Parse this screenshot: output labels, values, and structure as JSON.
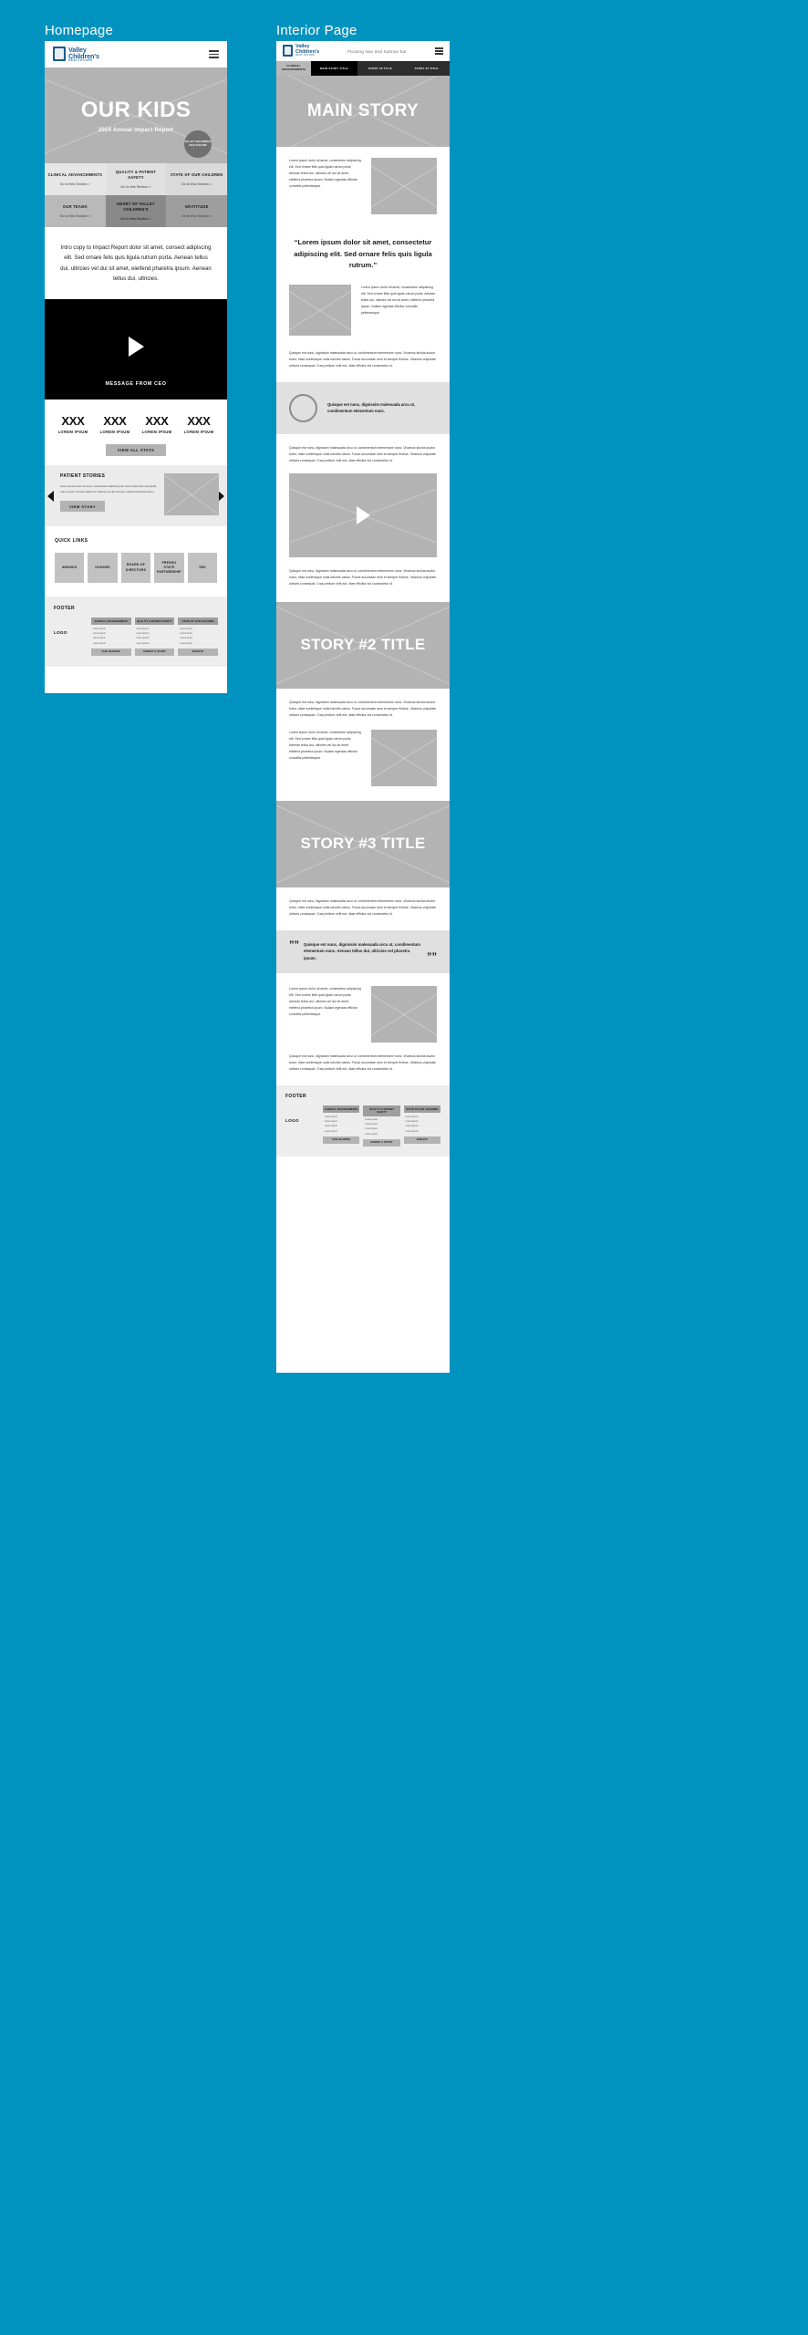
{
  "labels": {
    "homepage": "Homepage",
    "interior": "Interior Page"
  },
  "brand": {
    "accent": "#0093bf",
    "logo_line1": "Valley",
    "logo_line2": "Children's",
    "logo_line3": "HEALTHCARE"
  },
  "homepage": {
    "hero": {
      "title": "OUR KIDS",
      "subtitle": "2024 Annual Impact Report",
      "badge": "VALLEY CHILDREN'S HEALTHCARE"
    },
    "cards": [
      {
        "title": "CLINICAL ADVANCEMENTS",
        "link": "Go to this Section >"
      },
      {
        "title": "QUALITY & PATIENT SAFETY",
        "link": "Go to this Section >"
      },
      {
        "title": "STATE OF OUR CHILDREN",
        "link": "Go to this Section >"
      },
      {
        "title": "OUR TEAMS",
        "link": "Go to this Section >"
      },
      {
        "title": "HEART OF VALLEY CHILDREN'S",
        "link": "Go to this Section >"
      },
      {
        "title": "GRATITUDE",
        "link": "Go to this Section >"
      }
    ],
    "intro": "Intro copy to Impact Report dolor sit amet, consect adipiscing elit. Sed ornare felis quis ligula rutrum porta. Aenean tellus dui, ultricies vel dui sit amet, eieifend pharetra ipsum.  Aenean tellus dui, ultricies.",
    "video_caption": "MESSAGE FROM CEO",
    "stats": [
      {
        "number": "XXX",
        "caption": "LOREM IPSUM"
      },
      {
        "number": "XXX",
        "caption": "LOREM IPSUM"
      },
      {
        "number": "XXX",
        "caption": "LOREM IPSUM"
      },
      {
        "number": "XXX",
        "caption": "LOREM IPSUM"
      }
    ],
    "view_all_stats": "VIEW ALL STATS",
    "stories": {
      "heading": "PATIENT STORIES",
      "body": "Lorem ipsum dolor sit amet, consectetur adipiscing elit. Sed ornare felis quis ligula rutrum porta. Aenean tellus dui, ultricies vel dui sit amet, eleifend pharetra ipsum.",
      "button": "VIEW STORY"
    },
    "quick_links": {
      "heading": "QUICK LINKS",
      "items": [
        "AWARDS",
        "DONORS",
        "BOARD OF DIRECTORS",
        "FRESNO STATE PARTNERSHIP",
        "TBD"
      ]
    },
    "footer": {
      "title": "FOOTER",
      "logo": "LOGO",
      "columns": [
        {
          "header": "CLINICAL ADVANCEMENTS",
          "links": [
            "Lorem ipsum",
            "Lorem ipsum",
            "Lorem ipsum",
            "Lorem ipsum"
          ],
          "button": "SUB HEADING"
        },
        {
          "header": "QUALITY & PATIENT SAFETY",
          "links": [
            "Lorem ipsum",
            "Lorem ipsum",
            "Lorem ipsum",
            "Lorem ipsum"
          ],
          "button": "SUBMIT A STORY"
        },
        {
          "header": "STATE OF OUR CHILDREN",
          "links": [
            "Lorem ipsum",
            "Lorem ipsum",
            "Lorem ipsum",
            "Lorem ipsum"
          ],
          "button": "DONATE"
        }
      ]
    }
  },
  "interior": {
    "float_note": "Floating Nav and Subnav bar",
    "subnav": {
      "brand": "CLINICAL ADVANCEMENTS",
      "items": [
        {
          "label": "MAIN STORY TITLE",
          "active": true
        },
        {
          "label": "STORY #2 TITLE",
          "active": false
        },
        {
          "label": "STORY #3 TITLE",
          "active": false
        }
      ]
    },
    "hero_title": "MAIN STORY",
    "section1_text": "Lorem ipsum dolor sit amet, consectetur adipiscing elit. Sed ornare felis quis ligula rutrum porta. Aenean tellus dui, ultricies vel dui sit amet, eleifend pharetra ipsum. Nullam egestas efficitur convallis pellentesque.",
    "pullquote": "“Lorem ipsum dolor sit amet, consectetur adipiscing elit. Sed ornare felis quis ligula rutrum.”",
    "section2_text": "Lorem ipsum dolor sit amet, consectetur adipiscing elit. Sed ornare felis quis ligula rutrum porta. Aenean tellus dui, ultricies vel dui sit amet, eleifend pharetra ipsum. Nullam egestas efficitur convallis pellentesque.",
    "body_para": "Quisque est nunc, dignissim malesuada arcu ut, condimentum elementum nunc. Vivamus lacinia auctor tortor, vitae scelerisque nulla lobortis varius. Fusce accumsan sem et semper finibus. Vivamus vulputate ultrices consequat. Cras pretium velit est, vitae efficitur dui consectetur id.",
    "callout_text": "Quisque est nunc, dignissim malesuada arcu ut, condimentum elementum nunc.",
    "story2_title": "STORY #2 TITLE",
    "story3_title": "STORY #3 TITLE",
    "blockquote": "Quisque est nunc, dignissim malesuada arcu ut, condimentum elementum nunc. Aenean tellus dui, ultricies vel pharetra ipsum.",
    "quote_open": "””",
    "quote_close": "””",
    "story_column_text": "Lorem ipsum dolor sit amet, consectetur adipiscing elit. Sed ornare felis quis ligula rutrum porta. Aenean tellus dui, ultricies vel dui sit amet, eleifend pharetra ipsum. Nullam egestas efficitur convallis pellentesque.",
    "footer": {
      "title": "FOOTER",
      "logo": "LOGO",
      "columns": [
        {
          "header": "CLINICAL ADVANCEMENTS",
          "links": [
            "Lorem ipsum",
            "Lorem ipsum",
            "Lorem ipsum",
            "Lorem ipsum"
          ],
          "button": "SUB HEADING"
        },
        {
          "header": "QUALITY & PATIENT SAFETY",
          "links": [
            "Lorem ipsum",
            "Lorem ipsum",
            "Lorem ipsum",
            "Lorem ipsum"
          ],
          "button": "SUBMIT A STORY"
        },
        {
          "header": "STATE OF OUR CHILDREN",
          "links": [
            "Lorem ipsum",
            "Lorem ipsum",
            "Lorem ipsum",
            "Lorem ipsum"
          ],
          "button": "DONATE"
        }
      ]
    }
  }
}
